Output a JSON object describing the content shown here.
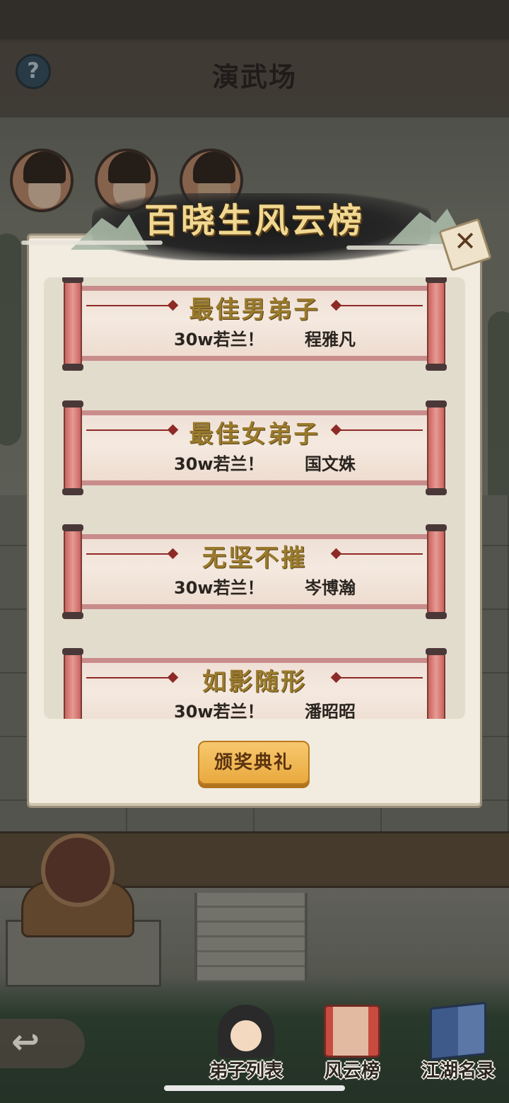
{
  "header": {
    "title": "演武场",
    "help_glyph": "?"
  },
  "modal": {
    "banner_title": "百晓生风云榜",
    "close_glyph": "✕",
    "awards": [
      {
        "title": "最佳男弟子",
        "reward": "30w若兰！",
        "winner": "程雅凡"
      },
      {
        "title": "最佳女弟子",
        "reward": "30w若兰！",
        "winner": "国文姝"
      },
      {
        "title": "无坚不摧",
        "reward": "30w若兰！",
        "winner": "岑博瀚"
      },
      {
        "title": "如影随形",
        "reward": "30w若兰！",
        "winner": "潘昭昭"
      }
    ],
    "ceremony_button": "颁奖典礼"
  },
  "bottom_nav": {
    "back_glyph": "↩",
    "items": [
      {
        "label": "弟子列表",
        "icon": "disciple-icon"
      },
      {
        "label": "风云榜",
        "icon": "scroll-icon"
      },
      {
        "label": "江湖名录",
        "icon": "book-icon"
      }
    ]
  },
  "colors": {
    "award_title": "#9a7a2c",
    "banner_title": "#f1d892",
    "button": "#e9a93d",
    "scroll_rod": "#c8645e"
  }
}
